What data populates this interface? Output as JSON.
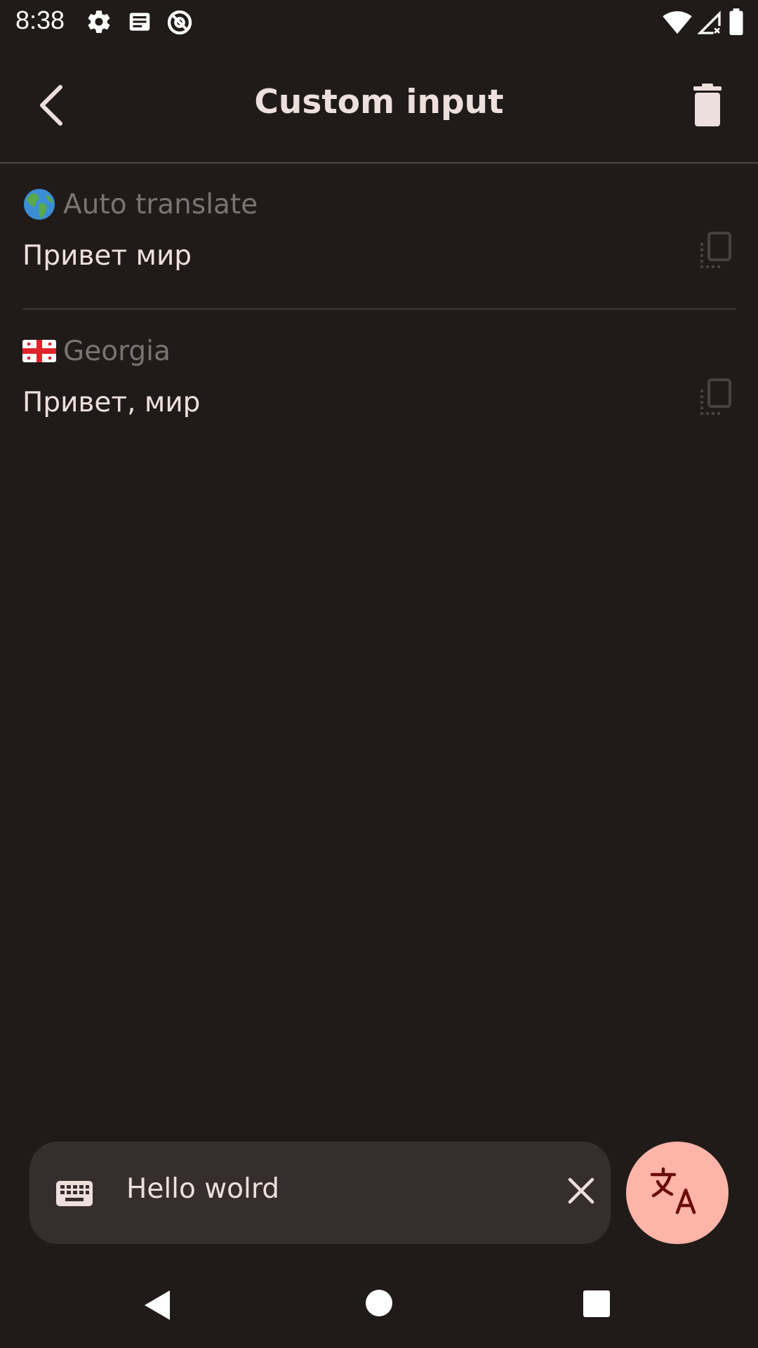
{
  "status_bar": {
    "time": "8:38",
    "icons": [
      "settings-icon",
      "news-icon",
      "at-sign-icon",
      "wifi-icon",
      "signal-icon",
      "battery-icon"
    ]
  },
  "app_bar": {
    "title": "Custom input",
    "back_icon": "chevron-left-icon",
    "delete_icon": "trash-icon"
  },
  "results": [
    {
      "language": "Auto translate",
      "flag_icon": "globe-europe-africa-icon",
      "text": "Привет мир",
      "copy_icon": "copy-icon"
    },
    {
      "language": "Georgia",
      "flag_icon": "flag-georgia-icon",
      "text": "Привет, мир",
      "copy_icon": "copy-icon"
    }
  ],
  "input": {
    "value": "Hello wolrd",
    "keyboard_icon": "keyboard-icon",
    "clear_icon": "close-icon"
  },
  "fab": {
    "icon": "translate-icon",
    "color": "#ffb4a8"
  },
  "nav_bar": {
    "back_icon": "nav-back-icon",
    "home_icon": "nav-home-icon",
    "recents_icon": "nav-recents-icon"
  },
  "colors": {
    "background": "#201b19",
    "surface": "#362e2c",
    "on_surface": "#ede0dc",
    "muted": "#7c7370",
    "accent": "#ffb4a8"
  }
}
